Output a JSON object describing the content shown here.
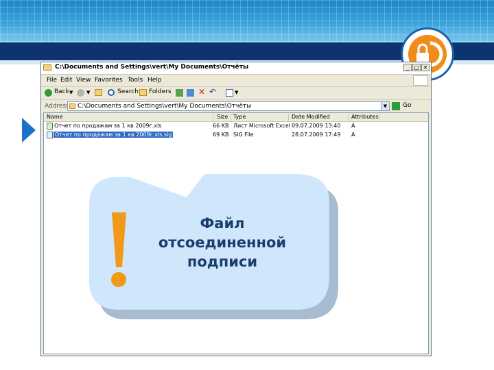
{
  "window": {
    "title": "C:\\Documents and Settings\\vert\\My Documents\\Отчёты",
    "menu": [
      "File",
      "Edit",
      "View",
      "Favorites",
      "Tools",
      "Help"
    ],
    "toolbar": {
      "back": "Back",
      "search": "Search",
      "folders": "Folders"
    },
    "address": {
      "label": "Address",
      "value": "C:\\Documents and Settings\\vert\\My Documents\\Отчёты",
      "go": "Go"
    },
    "columns": [
      "Name",
      "Size",
      "Type",
      "Date Modified",
      "Attributes"
    ],
    "files": [
      {
        "name": "Отчет по продажам за 1 кв 2009г.xls",
        "size": "66 KB",
        "type": "Лист Microsoft Excel",
        "date": "09.07.2009 13:40",
        "attr": "A",
        "selected": false
      },
      {
        "name": "Отчет по продажам за 1 кв 2009г.xls.sig",
        "size": "69 KB",
        "type": "SIG File",
        "date": "28.07.2009 17:49",
        "attr": "A",
        "selected": true
      }
    ]
  },
  "callout": {
    "line1": "Файл",
    "line2": "отсоединенной",
    "line3": "подписи",
    "mark": "!"
  },
  "colors": {
    "selection": "#316ac5",
    "callout_fill": "#cfe6fb",
    "exclamation": "#f19a1a",
    "header_dark": "#0d3470"
  }
}
